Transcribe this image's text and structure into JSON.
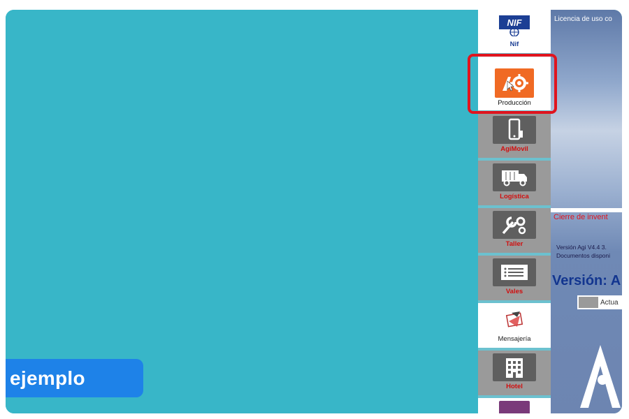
{
  "ribbon": {
    "text": "ejemplo"
  },
  "sidebar": {
    "items": [
      {
        "label": "Nif",
        "icon": "nif-logo-icon"
      },
      {
        "label": "Producción",
        "icon": "production-gears-icon"
      },
      {
        "label": "AgiMovil",
        "icon": "mobile-phone-icon"
      },
      {
        "label": "Logística",
        "icon": "truck-icon"
      },
      {
        "label": "Taller",
        "icon": "wrench-gears-icon"
      },
      {
        "label": "Vales",
        "icon": "voucher-icon"
      },
      {
        "label": "Mensajería",
        "icon": "messaging-icon"
      },
      {
        "label": "Hotel",
        "icon": "hotel-building-icon"
      }
    ]
  },
  "right_panel": {
    "license_text": "Licencia de uso co",
    "inventory_text": "Cierre de invent",
    "version_line": "Versión  Agi V4.4 3.",
    "documents_line": "Documentos disponi",
    "version_heading": "Versión: A",
    "update_button": "Actua"
  },
  "colors": {
    "workspace": "#38b6c8",
    "ribbon": "#1e82e8",
    "highlight": "#e0141e",
    "tile_label_red": "#d10f0f",
    "production_tile": "#f06a24"
  }
}
